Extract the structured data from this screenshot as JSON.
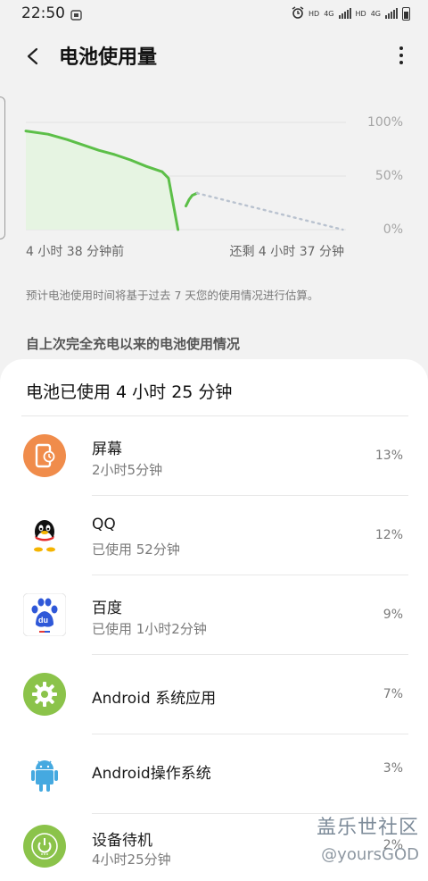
{
  "status_bar": {
    "time": "22:50",
    "indicators": [
      "HD",
      "4G",
      "HD",
      "4G"
    ],
    "left_icon": "notification-icon"
  },
  "header": {
    "title": "电池使用量",
    "back_icon": "back-arrow-icon",
    "more_icon": "more-vertical-icon"
  },
  "chart_data": {
    "type": "line",
    "y_ticks": [
      "100%",
      "50%",
      "0%"
    ],
    "ylim": [
      0,
      100
    ],
    "start_label": "4 小时 38 分钟前",
    "end_label": "还剩 4 小时 37 分钟",
    "colors": {
      "usage": "#5cbf48",
      "fill": "#e6f4e2",
      "prediction": "#b9c2cf",
      "grid": "#e3e3e3"
    },
    "usage": {
      "x_hours": [
        0,
        0.7,
        1.3,
        1.8,
        2.3,
        2.8,
        3.3,
        3.8,
        4.3,
        4.5,
        4.8,
        5.1,
        5.2,
        5.4
      ],
      "y": [
        92,
        89,
        84,
        79,
        74,
        70,
        65,
        59,
        54,
        48,
        0,
        0,
        0,
        0
      ]
    },
    "usage_segments": [
      {
        "x_hours": [
          0,
          0.7,
          1.3,
          1.8,
          2.3,
          2.8,
          3.3,
          3.8,
          4.3,
          4.5,
          4.8
        ],
        "y": [
          92,
          89,
          84,
          79,
          74,
          70,
          65,
          59,
          54,
          48,
          0
        ]
      },
      {
        "x_hours": [
          5.05,
          5.15,
          5.25,
          5.4
        ],
        "y": [
          22,
          28,
          32,
          34
        ]
      }
    ],
    "prediction": {
      "x_hours": [
        5.4,
        10.0
      ],
      "y": [
        34,
        0
      ]
    },
    "x_range": [
      0,
      10.1
    ]
  },
  "note": "预计电池使用时间将基于过去 7 天您的使用情况进行估算。",
  "section_title": "自上次完全充电以来的电池使用情况",
  "usage_card": {
    "title": "电池已使用 4 小时 25 分钟",
    "items": [
      {
        "name": "屏幕",
        "sub": "2小时5分钟",
        "pct": "13%",
        "icon": "screen-icon",
        "color": "#f08c4b"
      },
      {
        "name": "QQ",
        "sub": "已使用 52分钟",
        "pct": "12%",
        "icon": "qq-penguin-icon",
        "color": "#111111"
      },
      {
        "name": "百度",
        "sub": "已使用 1小时2分钟",
        "pct": "9%",
        "icon": "baidu-paw-icon",
        "color": "#2f58d8"
      },
      {
        "name": "Android 系统应用",
        "sub": "",
        "pct": "7%",
        "icon": "gear-icon",
        "color": "#8bc34a"
      },
      {
        "name": "Android操作系统",
        "sub": "",
        "pct": "3%",
        "icon": "android-robot-icon",
        "color": "#45a9e0"
      },
      {
        "name": "设备待机",
        "sub": "4小时25分钟",
        "pct": "2%",
        "icon": "power-icon",
        "color": "#8bc34a"
      }
    ]
  },
  "watermark": {
    "line1": "盖乐世社区",
    "line2": "@yoursGOD"
  }
}
